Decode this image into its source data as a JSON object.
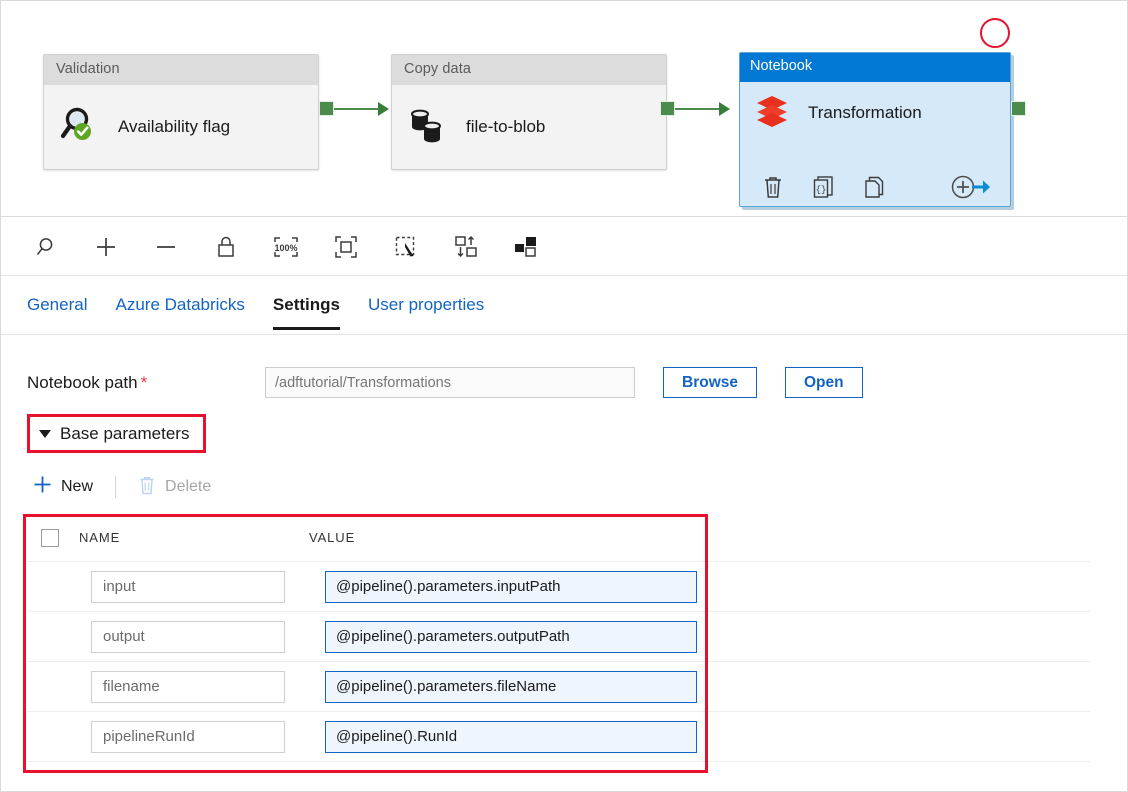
{
  "canvas": {
    "nodes": [
      {
        "type": "Validation",
        "name": "Availability flag",
        "icon": "magnifier-check-icon",
        "selected": false
      },
      {
        "type": "Copy data",
        "name": "file-to-blob",
        "icon": "database-copy-icon",
        "selected": false
      },
      {
        "type": "Notebook",
        "name": "Transformation",
        "icon": "databricks-icon",
        "selected": true,
        "actions": [
          {
            "name": "delete-activity",
            "icon": "trash-icon"
          },
          {
            "name": "code-activity",
            "icon": "code-braces-icon"
          },
          {
            "name": "clone-activity",
            "icon": "copy-pages-icon"
          },
          {
            "name": "add-output-activity",
            "icon": "plus-arrow-icon"
          }
        ]
      }
    ],
    "annotation": {
      "name": "red-circle-annotation",
      "color": "#e8112d"
    },
    "connector_color": "#4b8b4b"
  },
  "toolbar": {
    "items": [
      {
        "name": "zoom-search-icon",
        "label": "Search"
      },
      {
        "name": "zoom-in-icon",
        "label": "Zoom in"
      },
      {
        "name": "zoom-out-icon",
        "label": "Zoom out"
      },
      {
        "name": "lock-icon",
        "label": "Lock"
      },
      {
        "name": "zoom-100-percent-icon",
        "label": "100%"
      },
      {
        "name": "fit-to-screen-icon",
        "label": "Zoom to fit"
      },
      {
        "name": "marquee-select-icon",
        "label": "Select"
      },
      {
        "name": "auto-align-icon",
        "label": "Auto align"
      },
      {
        "name": "layout-icon",
        "label": "Layout"
      }
    ],
    "zoom_level": "100%"
  },
  "tabs": [
    {
      "label": "General",
      "active": false
    },
    {
      "label": "Azure Databricks",
      "active": false
    },
    {
      "label": "Settings",
      "active": true
    },
    {
      "label": "User properties",
      "active": false
    }
  ],
  "settings": {
    "notebook_path": {
      "label": "Notebook path",
      "required_marker": "*",
      "value": "/adftutorial/Transformations",
      "placeholder": "/adftutorial/Transformations"
    },
    "browse_label": "Browse",
    "open_label": "Open",
    "base_parameters": {
      "section_label": "Base parameters",
      "expanded": true,
      "commands": {
        "new_label": "New",
        "delete_label": "Delete",
        "delete_disabled": true
      },
      "columns": [
        "NAME",
        "VALUE"
      ],
      "rows": [
        {
          "name": "input",
          "value": "@pipeline().parameters.inputPath"
        },
        {
          "name": "output",
          "value": "@pipeline().parameters.outputPath"
        },
        {
          "name": "filename",
          "value": "@pipeline().parameters.fileName"
        },
        {
          "name": "pipelineRunId",
          "value": "@pipeline().RunId"
        }
      ]
    }
  },
  "colors": {
    "accent_blue": "#1364c4",
    "node_header_blue": "#0078d4",
    "annotation_red": "#e8112d",
    "connector_green": "#4b8b4b"
  }
}
